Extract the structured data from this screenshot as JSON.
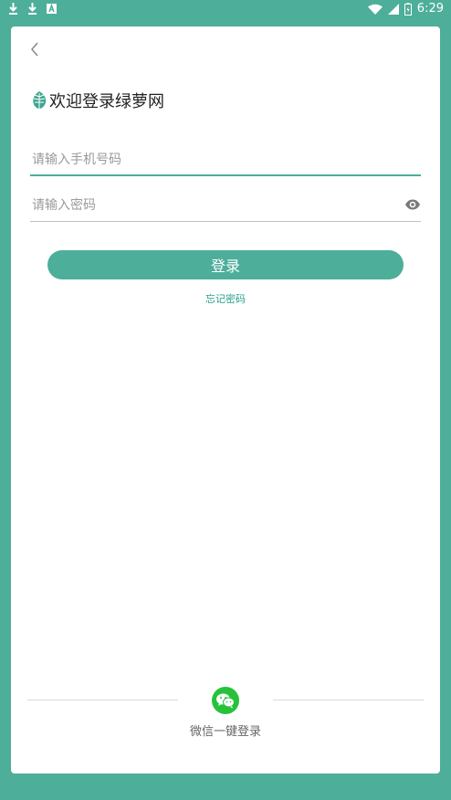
{
  "status_bar": {
    "left_icons": [
      "download-icon",
      "download-icon",
      "a-badge-icon"
    ],
    "right_icons": [
      "wifi-icon",
      "signal-icon",
      "battery-icon"
    ],
    "time": "6:29"
  },
  "header": {
    "back_icon": "chevron-left-icon",
    "logo_icon": "leaf-icon",
    "title": "欢迎登录绿萝网"
  },
  "form": {
    "phone_placeholder": "请输入手机号码",
    "phone_value": "",
    "password_placeholder": "请输入密码",
    "password_value": "",
    "eye_icon": "eye-icon",
    "login_label": "登录",
    "forgot_label": "忘记密码"
  },
  "social": {
    "wechat_icon": "wechat-icon",
    "wechat_label": "微信一键登录"
  },
  "colors": {
    "accent": "#4dae9a",
    "link": "#2aa08e",
    "wechat": "#28c13c"
  }
}
